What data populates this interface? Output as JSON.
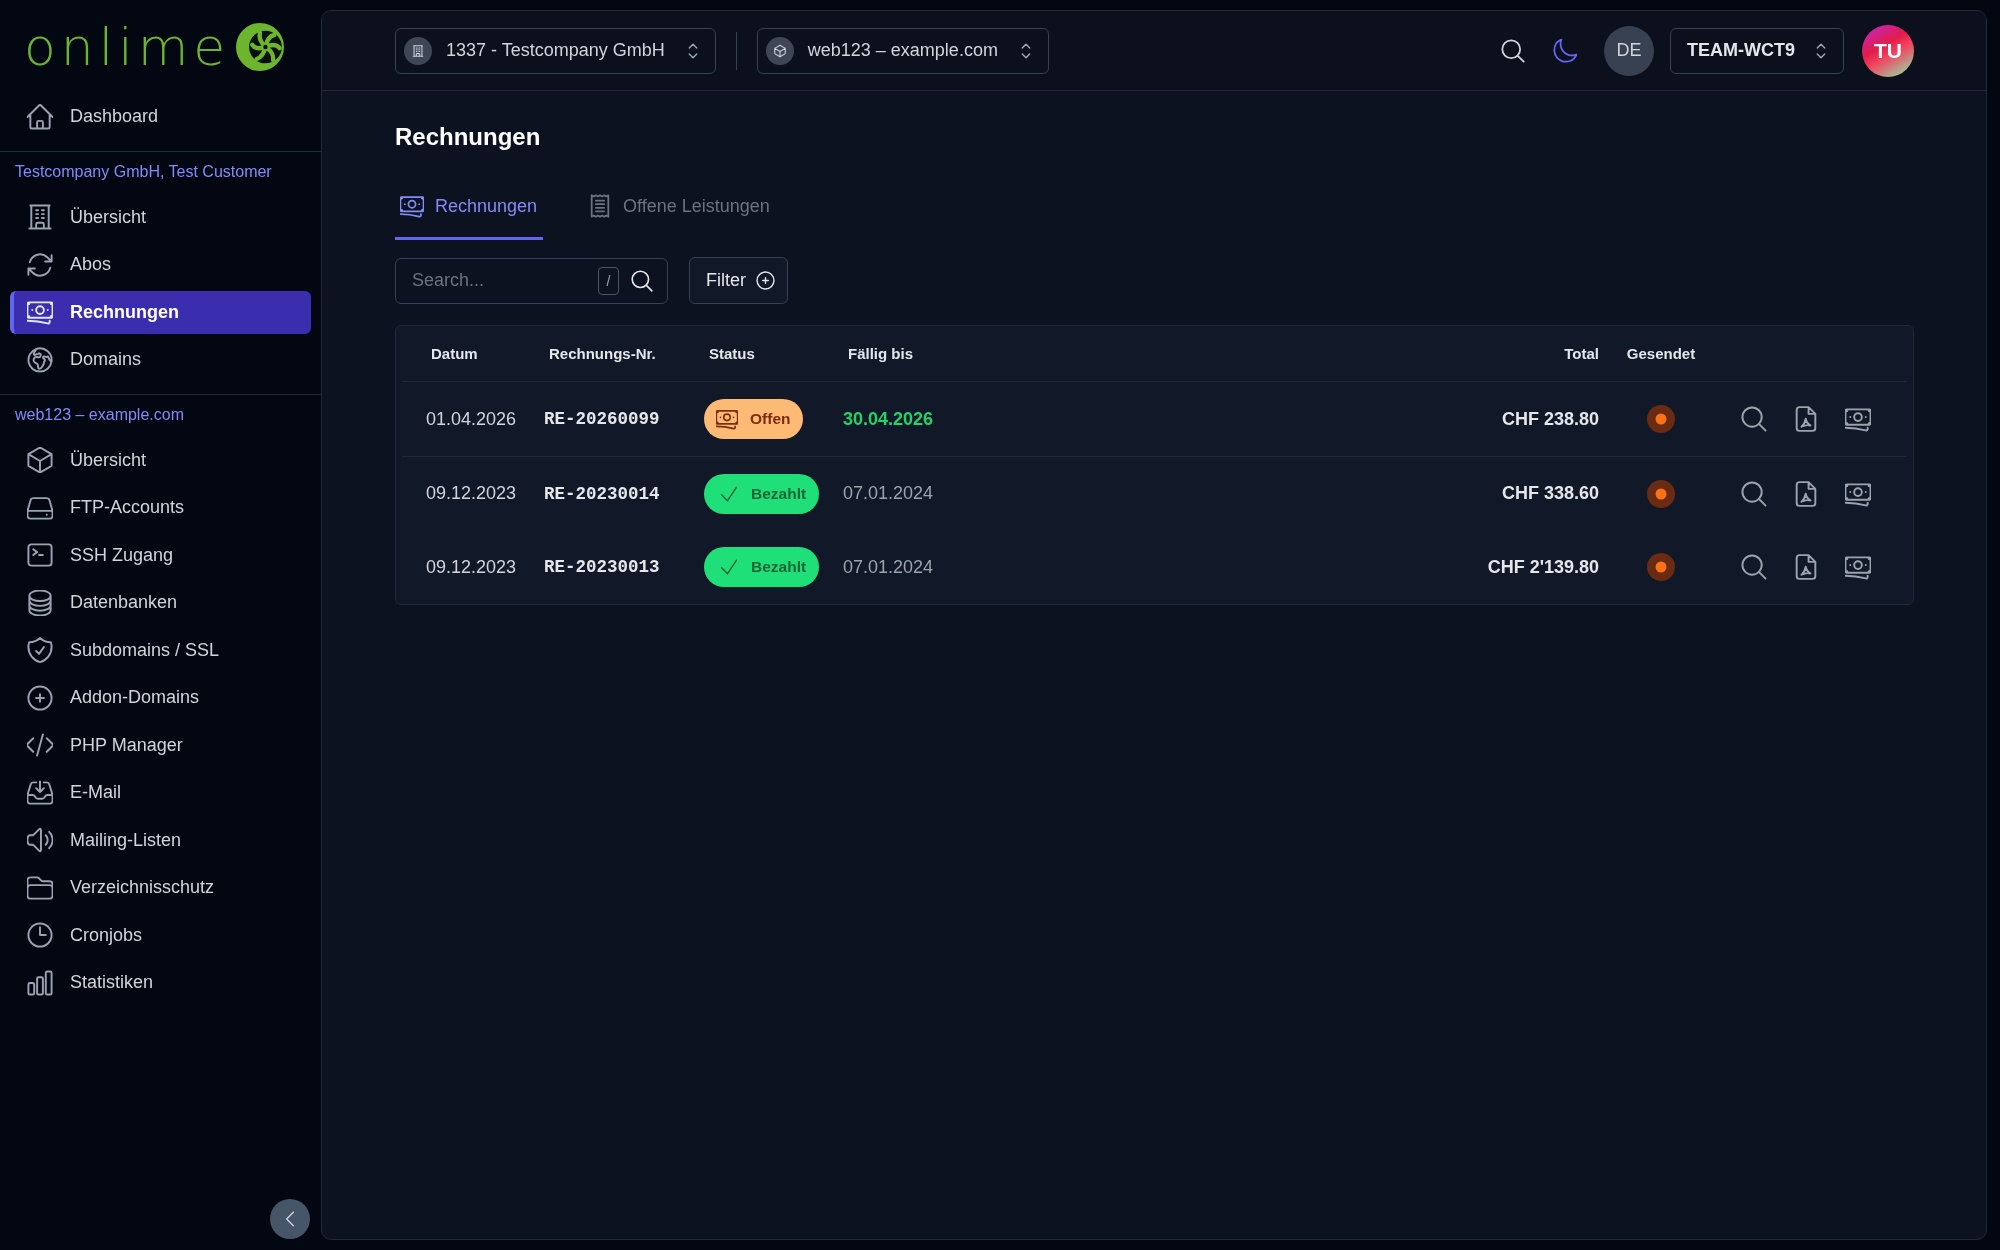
{
  "sidebar": {
    "logo_text": "onlime",
    "groups": [
      {
        "items": [
          {
            "label": "Dashboard",
            "selected": false
          }
        ]
      },
      {
        "title": "Testcompany GmbH, Test Customer",
        "items": [
          {
            "label": "Übersicht",
            "selected": false
          },
          {
            "label": "Abos",
            "selected": false
          },
          {
            "label": "Rechnungen",
            "selected": true
          },
          {
            "label": "Domains",
            "selected": false
          }
        ]
      },
      {
        "title": "web123 – example.com",
        "items": [
          {
            "label": "Übersicht",
            "selected": false
          },
          {
            "label": "FTP-Accounts",
            "selected": false
          },
          {
            "label": "SSH Zugang",
            "selected": false
          },
          {
            "label": "Datenbanken",
            "selected": false
          },
          {
            "label": "Subdomains / SSL",
            "selected": false
          },
          {
            "label": "Addon-Domains",
            "selected": false
          },
          {
            "label": "PHP Manager",
            "selected": false
          },
          {
            "label": "E-Mail",
            "selected": false
          },
          {
            "label": "Mailing-Listen",
            "selected": false
          },
          {
            "label": "Verzeichnisschutz",
            "selected": false
          },
          {
            "label": "Cronjobs",
            "selected": false
          },
          {
            "label": "Statistiken",
            "selected": false
          }
        ]
      }
    ]
  },
  "topbar": {
    "selectors": [
      {
        "value": "1337 - Testcompany GmbH"
      },
      {
        "value": "web123 – example.com"
      }
    ],
    "language": "DE",
    "team": "TEAM-WCT9",
    "avatar_initials": "TU"
  },
  "page": {
    "title": "Rechnungen"
  },
  "tabs": [
    {
      "label": "Rechnungen",
      "selected": true
    },
    {
      "label": "Offene Leistungen",
      "selected": false
    }
  ],
  "search": {
    "placeholder": "Search...",
    "shortcut": "/"
  },
  "filter_button": "Filter",
  "table": {
    "columns": [
      "Datum",
      "Rechnungs-Nr.",
      "Status",
      "Fällig bis",
      "Total",
      "Gesendet"
    ],
    "rows": [
      {
        "date": "01.04.2026",
        "number": "RE-20260099",
        "status": {
          "kind": "open",
          "label": "Offen"
        },
        "due": "30.04.2026",
        "due_highlighted": true,
        "total": "CHF 238.80",
        "sent": false
      },
      {
        "date": "09.12.2023",
        "number": "RE-20230014",
        "status": {
          "kind": "paid",
          "label": "Bezahlt"
        },
        "due": "07.01.2024",
        "due_highlighted": false,
        "total": "CHF 338.60",
        "sent": false
      },
      {
        "date": "09.12.2023",
        "number": "RE-20230013",
        "status": {
          "kind": "paid",
          "label": "Bezahlt"
        },
        "due": "07.01.2024",
        "due_highlighted": false,
        "total": "CHF 2'139.80",
        "sent": false
      }
    ]
  }
}
